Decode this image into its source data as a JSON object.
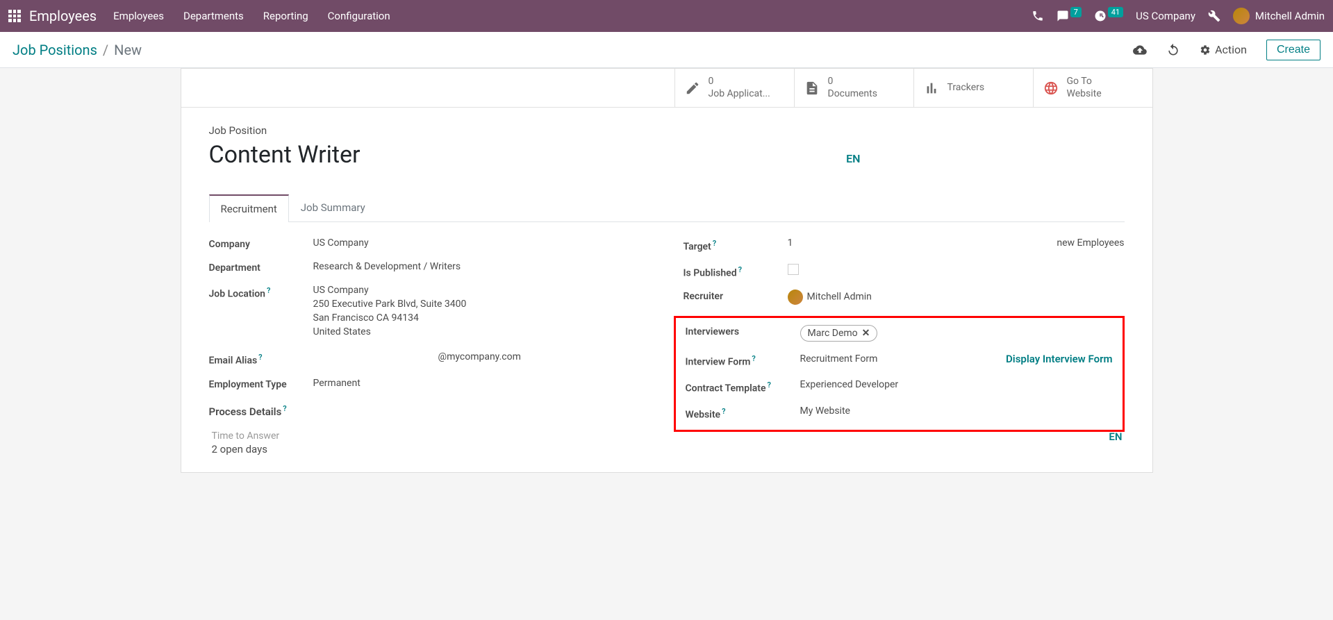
{
  "navbar": {
    "app_name": "Employees",
    "menu": [
      "Employees",
      "Departments",
      "Reporting",
      "Configuration"
    ],
    "messages_badge": "7",
    "activities_badge": "41",
    "company": "US Company",
    "user_name": "Mitchell Admin"
  },
  "control_panel": {
    "breadcrumb_root": "Job Positions",
    "breadcrumb_current": "New",
    "action_label": "Action",
    "create_label": "Create"
  },
  "stat_buttons": {
    "job_app_count": "0",
    "job_app_label": "Job Applicat...",
    "documents_count": "0",
    "documents_label": "Documents",
    "trackers_label": "Trackers",
    "website_label_1": "Go To",
    "website_label_2": "Website"
  },
  "form": {
    "title_label": "Job Position",
    "title_value": "Content Writer",
    "lang_indicator": "EN",
    "tabs": {
      "recruitment": "Recruitment",
      "summary": "Job Summary"
    },
    "left": {
      "company_label": "Company",
      "company_value": "US Company",
      "department_label": "Department",
      "department_value": "Research & Development / Writers",
      "job_location_label": "Job Location",
      "job_location_1": "US Company",
      "job_location_2": "250 Executive Park Blvd, Suite 3400",
      "job_location_3": "San Francisco CA 94134",
      "job_location_4": "United States",
      "email_alias_label": "Email Alias",
      "email_alias_suffix": "@mycompany.com",
      "employment_type_label": "Employment Type",
      "employment_type_value": "Permanent",
      "process_details_label": "Process Details",
      "time_to_answer_label": "Time to Answer",
      "time_to_answer_value": "2 open days"
    },
    "right": {
      "target_label": "Target",
      "target_value": "1",
      "target_suffix": "new Employees",
      "is_published_label": "Is Published",
      "recruiter_label": "Recruiter",
      "recruiter_value": "Mitchell Admin",
      "interviewers_label": "Interviewers",
      "interviewers_tag": "Marc Demo",
      "interview_form_label": "Interview Form",
      "interview_form_value": "Recruitment Form",
      "display_interview": "Display Interview Form",
      "contract_template_label": "Contract Template",
      "contract_template_value": "Experienced Developer",
      "website_label": "Website",
      "website_value": "My Website"
    },
    "en_footer": "EN"
  }
}
